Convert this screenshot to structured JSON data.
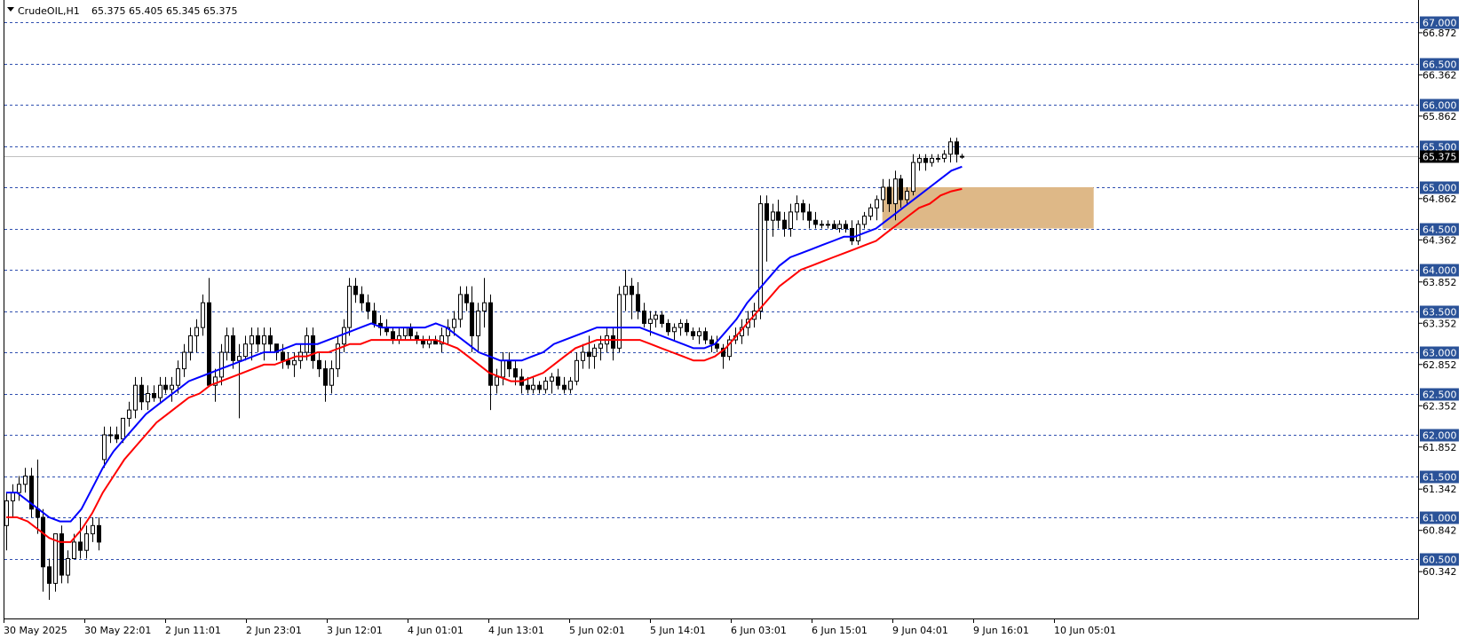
{
  "header": {
    "symbol": "CrudeOIL,H1",
    "ohlc": "65.375 65.405 65.345 65.375",
    "menu_icon": "triangle-down-icon"
  },
  "colors": {
    "background": "#ffffff",
    "bull_candle": "#ffffff",
    "bear_candle": "#000000",
    "ma_fast": "#0000ff",
    "ma_slow": "#ff0000",
    "level_line": "#3050b0",
    "level_tag": "#2a5298",
    "current_price_line": "#c0c0c0",
    "current_price_tag": "#000000",
    "zone_fill": "#deb887"
  },
  "chart_data": {
    "type": "candlestick",
    "title": "CrudeOIL,H1",
    "ylim": [
      60.2,
      67.2
    ],
    "y_tick_labels": [
      "66.872",
      "66.362",
      "65.862",
      "65.352",
      "64.862",
      "64.362",
      "63.852",
      "63.352",
      "62.852",
      "62.352",
      "61.852",
      "61.342",
      "60.842",
      "60.342"
    ],
    "level_lines": [
      "67.000",
      "66.500",
      "66.000",
      "65.500",
      "65.000",
      "64.500",
      "64.000",
      "63.500",
      "63.000",
      "62.500",
      "62.000",
      "61.500",
      "61.000",
      "60.500"
    ],
    "current_price": "65.375",
    "x_labels": [
      "30 May 2025",
      "30 May 22:01",
      "2 Jun 11:01",
      "2 Jun 23:01",
      "3 Jun 12:01",
      "4 Jun 01:01",
      "4 Jun 13:01",
      "5 Jun 02:01",
      "5 Jun 14:01",
      "6 Jun 03:01",
      "6 Jun 15:01",
      "9 Jun 04:01",
      "9 Jun 16:01",
      "10 Jun 05:01"
    ],
    "zone": {
      "bar_start": 143,
      "bar_end": 163,
      "high": 65.0,
      "low": 64.5
    },
    "ohlc": [
      [
        60.9,
        61.3,
        60.6,
        61.2
      ],
      [
        61.2,
        61.4,
        61.0,
        61.3
      ],
      [
        61.3,
        61.5,
        61.2,
        61.4
      ],
      [
        61.4,
        61.6,
        61.3,
        61.5
      ],
      [
        61.5,
        61.6,
        61.0,
        61.1
      ],
      [
        61.1,
        61.7,
        60.8,
        61.0
      ],
      [
        61.0,
        61.1,
        60.1,
        60.4
      ],
      [
        60.4,
        60.5,
        60.0,
        60.2
      ],
      [
        60.2,
        60.8,
        60.1,
        60.8
      ],
      [
        60.8,
        60.9,
        60.2,
        60.3
      ],
      [
        60.3,
        60.6,
        60.2,
        60.5
      ],
      [
        60.5,
        60.8,
        60.5,
        60.7
      ],
      [
        60.7,
        61.0,
        60.5,
        60.6
      ],
      [
        60.6,
        60.9,
        60.5,
        60.8
      ],
      [
        60.8,
        61.0,
        60.7,
        60.9
      ],
      [
        60.9,
        61.0,
        60.6,
        60.7
      ],
      [
        61.7,
        62.1,
        61.6,
        62.0
      ],
      [
        62.0,
        62.1,
        61.9,
        62.0
      ],
      [
        62.0,
        62.1,
        61.9,
        61.95
      ],
      [
        61.95,
        62.2,
        61.9,
        62.2
      ],
      [
        62.2,
        62.4,
        62.1,
        62.3
      ],
      [
        62.3,
        62.7,
        62.2,
        62.6
      ],
      [
        62.6,
        62.7,
        62.3,
        62.4
      ],
      [
        62.4,
        62.6,
        62.3,
        62.5
      ],
      [
        62.5,
        62.6,
        62.4,
        62.45
      ],
      [
        62.45,
        62.7,
        62.4,
        62.6
      ],
      [
        62.6,
        62.7,
        62.5,
        62.55
      ],
      [
        62.55,
        62.7,
        62.4,
        62.6
      ],
      [
        62.6,
        62.9,
        62.5,
        62.8
      ],
      [
        62.8,
        63.1,
        62.7,
        63.0
      ],
      [
        63.0,
        63.3,
        62.9,
        63.2
      ],
      [
        63.2,
        63.4,
        63.0,
        63.3
      ],
      [
        63.3,
        63.7,
        63.2,
        63.6
      ],
      [
        63.6,
        63.9,
        63.4,
        62.6
      ],
      [
        62.6,
        62.8,
        62.4,
        62.7
      ],
      [
        62.7,
        63.1,
        62.6,
        63.0
      ],
      [
        63.0,
        63.3,
        62.9,
        63.2
      ],
      [
        63.2,
        63.3,
        62.8,
        62.9
      ],
      [
        62.9,
        63.1,
        62.2,
        62.95
      ],
      [
        62.95,
        63.2,
        62.9,
        63.1
      ],
      [
        63.1,
        63.3,
        62.9,
        63.2
      ],
      [
        63.2,
        63.3,
        63.0,
        63.1
      ],
      [
        63.1,
        63.3,
        62.9,
        63.2
      ],
      [
        63.2,
        63.3,
        63.0,
        63.1
      ],
      [
        63.1,
        63.1,
        62.9,
        63.0
      ],
      [
        63.0,
        63.1,
        62.8,
        62.9
      ],
      [
        62.9,
        63.0,
        62.8,
        62.85
      ],
      [
        62.85,
        63.0,
        62.7,
        62.9
      ],
      [
        62.9,
        63.1,
        62.8,
        63.0
      ],
      [
        63.0,
        63.3,
        62.9,
        63.2
      ],
      [
        63.2,
        63.3,
        62.8,
        62.9
      ],
      [
        62.9,
        63.0,
        62.7,
        62.8
      ],
      [
        62.8,
        62.9,
        62.4,
        62.6
      ],
      [
        62.6,
        62.9,
        62.5,
        62.8
      ],
      [
        62.8,
        63.2,
        62.7,
        63.1
      ],
      [
        63.1,
        63.4,
        63.0,
        63.3
      ],
      [
        63.3,
        63.9,
        63.2,
        63.8
      ],
      [
        63.8,
        63.9,
        63.6,
        63.7
      ],
      [
        63.7,
        63.8,
        63.5,
        63.6
      ],
      [
        63.6,
        63.7,
        63.4,
        63.5
      ],
      [
        63.5,
        63.6,
        63.3,
        63.35
      ],
      [
        63.35,
        63.45,
        63.2,
        63.3
      ],
      [
        63.3,
        63.4,
        63.2,
        63.25
      ],
      [
        63.25,
        63.3,
        63.1,
        63.15
      ],
      [
        63.15,
        63.3,
        63.1,
        63.2
      ],
      [
        63.2,
        63.3,
        63.15,
        63.3
      ],
      [
        63.3,
        63.35,
        63.15,
        63.2
      ],
      [
        63.2,
        63.25,
        63.1,
        63.15
      ],
      [
        63.15,
        63.2,
        63.05,
        63.1
      ],
      [
        63.1,
        63.2,
        63.05,
        63.15
      ],
      [
        63.15,
        63.2,
        63.1,
        63.1
      ],
      [
        63.1,
        63.3,
        63.0,
        63.2
      ],
      [
        63.2,
        63.4,
        63.1,
        63.3
      ],
      [
        63.3,
        63.5,
        63.2,
        63.4
      ],
      [
        63.4,
        63.8,
        63.3,
        63.7
      ],
      [
        63.7,
        63.8,
        63.5,
        63.6
      ],
      [
        63.6,
        63.8,
        63.0,
        63.2
      ],
      [
        63.2,
        63.6,
        63.0,
        63.5
      ],
      [
        63.5,
        63.9,
        63.3,
        63.6
      ],
      [
        63.6,
        63.7,
        62.3,
        62.6
      ],
      [
        62.6,
        62.8,
        62.5,
        62.7
      ],
      [
        62.7,
        63.0,
        62.6,
        62.9
      ],
      [
        62.9,
        63.0,
        62.7,
        62.8
      ],
      [
        62.8,
        62.9,
        62.6,
        62.7
      ],
      [
        62.7,
        62.8,
        62.5,
        62.6
      ],
      [
        62.6,
        62.7,
        62.5,
        62.55
      ],
      [
        62.55,
        62.7,
        62.5,
        62.6
      ],
      [
        62.6,
        62.65,
        62.5,
        62.55
      ],
      [
        62.55,
        62.7,
        62.5,
        62.65
      ],
      [
        62.65,
        62.75,
        62.5,
        62.7
      ],
      [
        62.7,
        62.8,
        62.55,
        62.6
      ],
      [
        62.6,
        62.7,
        62.5,
        62.55
      ],
      [
        62.55,
        62.7,
        62.5,
        62.65
      ],
      [
        62.65,
        63.0,
        62.6,
        62.9
      ],
      [
        62.9,
        63.1,
        62.8,
        63.0
      ],
      [
        63.0,
        63.2,
        62.8,
        62.95
      ],
      [
        62.95,
        63.1,
        62.8,
        63.05
      ],
      [
        63.05,
        63.2,
        62.9,
        63.1
      ],
      [
        63.1,
        63.3,
        63.0,
        63.2
      ],
      [
        63.2,
        63.3,
        62.9,
        63.05
      ],
      [
        63.05,
        63.8,
        63.0,
        63.7
      ],
      [
        63.7,
        64.0,
        63.5,
        63.8
      ],
      [
        63.8,
        63.9,
        63.4,
        63.7
      ],
      [
        63.7,
        63.85,
        63.4,
        63.5
      ],
      [
        63.5,
        63.6,
        63.3,
        63.35
      ],
      [
        63.35,
        63.5,
        63.2,
        63.4
      ],
      [
        63.4,
        63.5,
        63.3,
        63.45
      ],
      [
        63.45,
        63.5,
        63.3,
        63.35
      ],
      [
        63.35,
        63.4,
        63.2,
        63.25
      ],
      [
        63.25,
        63.35,
        63.15,
        63.3
      ],
      [
        63.3,
        63.4,
        63.2,
        63.35
      ],
      [
        63.35,
        63.4,
        63.2,
        63.25
      ],
      [
        63.25,
        63.3,
        63.15,
        63.2
      ],
      [
        63.2,
        63.3,
        63.1,
        63.25
      ],
      [
        63.25,
        63.3,
        63.1,
        63.15
      ],
      [
        63.15,
        63.2,
        63.0,
        63.1
      ],
      [
        63.1,
        63.2,
        63.0,
        63.05
      ],
      [
        63.05,
        63.1,
        62.8,
        62.95
      ],
      [
        62.95,
        63.2,
        62.9,
        63.15
      ],
      [
        63.15,
        63.3,
        63.1,
        63.2
      ],
      [
        63.2,
        63.4,
        63.1,
        63.3
      ],
      [
        63.3,
        63.5,
        63.2,
        63.4
      ],
      [
        63.4,
        63.6,
        63.3,
        63.5
      ],
      [
        63.5,
        64.9,
        63.4,
        64.8
      ],
      [
        64.8,
        64.9,
        64.1,
        64.6
      ],
      [
        64.6,
        64.8,
        64.4,
        64.7
      ],
      [
        64.7,
        64.85,
        64.5,
        64.6
      ],
      [
        64.6,
        64.7,
        64.4,
        64.5
      ],
      [
        64.5,
        64.8,
        64.4,
        64.7
      ],
      [
        64.7,
        64.9,
        64.6,
        64.8
      ],
      [
        64.8,
        64.85,
        64.6,
        64.7
      ],
      [
        64.7,
        64.8,
        64.5,
        64.6
      ],
      [
        64.6,
        64.7,
        64.5,
        64.55
      ],
      [
        64.55,
        64.6,
        64.5,
        64.55
      ],
      [
        64.55,
        64.6,
        64.5,
        64.55
      ],
      [
        64.55,
        64.6,
        64.5,
        64.5
      ],
      [
        64.5,
        64.6,
        64.45,
        64.55
      ],
      [
        64.55,
        64.6,
        64.45,
        64.5
      ],
      [
        64.5,
        64.6,
        64.3,
        64.35
      ],
      [
        64.35,
        64.6,
        64.3,
        64.55
      ],
      [
        64.55,
        64.7,
        64.5,
        64.65
      ],
      [
        64.65,
        64.8,
        64.6,
        64.75
      ],
      [
        64.75,
        64.9,
        64.6,
        64.85
      ],
      [
        64.85,
        65.1,
        64.7,
        65.0
      ],
      [
        65.0,
        65.1,
        64.7,
        64.8
      ],
      [
        64.8,
        65.2,
        64.6,
        65.1
      ],
      [
        65.1,
        65.15,
        64.75,
        64.85
      ],
      [
        64.85,
        65.0,
        64.8,
        64.95
      ],
      [
        64.95,
        65.4,
        64.9,
        65.3
      ],
      [
        65.3,
        65.4,
        65.2,
        65.35
      ],
      [
        65.35,
        65.4,
        65.2,
        65.3
      ],
      [
        65.3,
        65.4,
        65.25,
        65.35
      ],
      [
        65.35,
        65.4,
        65.3,
        65.35
      ],
      [
        65.35,
        65.45,
        65.3,
        65.4
      ],
      [
        65.4,
        65.6,
        65.3,
        65.55
      ],
      [
        65.55,
        65.6,
        65.3,
        65.4
      ],
      [
        65.375,
        65.405,
        65.345,
        65.375
      ]
    ],
    "ma_fast": [
      61.3,
      61.3,
      61.2,
      61.1,
      61.0,
      60.95,
      60.95,
      61.1,
      61.35,
      61.6,
      61.8,
      61.95,
      62.1,
      62.25,
      62.35,
      62.45,
      62.55,
      62.65,
      62.7,
      62.75,
      62.8,
      62.85,
      62.9,
      62.95,
      63.0,
      63.0,
      63.05,
      63.1,
      63.1,
      63.1,
      63.15,
      63.2,
      63.25,
      63.3,
      63.35,
      63.3,
      63.3,
      63.3,
      63.3,
      63.3,
      63.35,
      63.3,
      63.2,
      63.1,
      63.0,
      62.95,
      62.9,
      62.9,
      62.9,
      62.95,
      63.0,
      63.1,
      63.15,
      63.2,
      63.25,
      63.3,
      63.3,
      63.3,
      63.3,
      63.3,
      63.25,
      63.2,
      63.15,
      63.1,
      63.05,
      63.05,
      63.1,
      63.25,
      63.4,
      63.6,
      63.75,
      63.9,
      64.05,
      64.15,
      64.2,
      64.25,
      64.3,
      64.35,
      64.4,
      64.4,
      64.45,
      64.5,
      64.6,
      64.7,
      64.8,
      64.9,
      65.0,
      65.1,
      65.2,
      65.25
    ],
    "ma_slow": [
      61.0,
      61.0,
      60.95,
      60.85,
      60.75,
      60.7,
      60.7,
      60.85,
      61.05,
      61.3,
      61.5,
      61.7,
      61.85,
      62.0,
      62.15,
      62.25,
      62.35,
      62.45,
      62.5,
      62.6,
      62.65,
      62.7,
      62.75,
      62.8,
      62.85,
      62.85,
      62.9,
      62.95,
      62.95,
      63.0,
      63.0,
      63.05,
      63.1,
      63.1,
      63.15,
      63.15,
      63.15,
      63.15,
      63.15,
      63.15,
      63.15,
      63.1,
      63.05,
      62.95,
      62.85,
      62.75,
      62.7,
      62.65,
      62.65,
      62.7,
      62.75,
      62.85,
      62.95,
      63.05,
      63.1,
      63.15,
      63.15,
      63.15,
      63.15,
      63.15,
      63.1,
      63.05,
      63.0,
      62.95,
      62.9,
      62.9,
      62.95,
      63.05,
      63.2,
      63.35,
      63.5,
      63.65,
      63.8,
      63.9,
      64.0,
      64.05,
      64.1,
      64.15,
      64.2,
      64.25,
      64.3,
      64.35,
      64.45,
      64.55,
      64.65,
      64.75,
      64.8,
      64.9,
      64.95,
      64.98
    ]
  }
}
